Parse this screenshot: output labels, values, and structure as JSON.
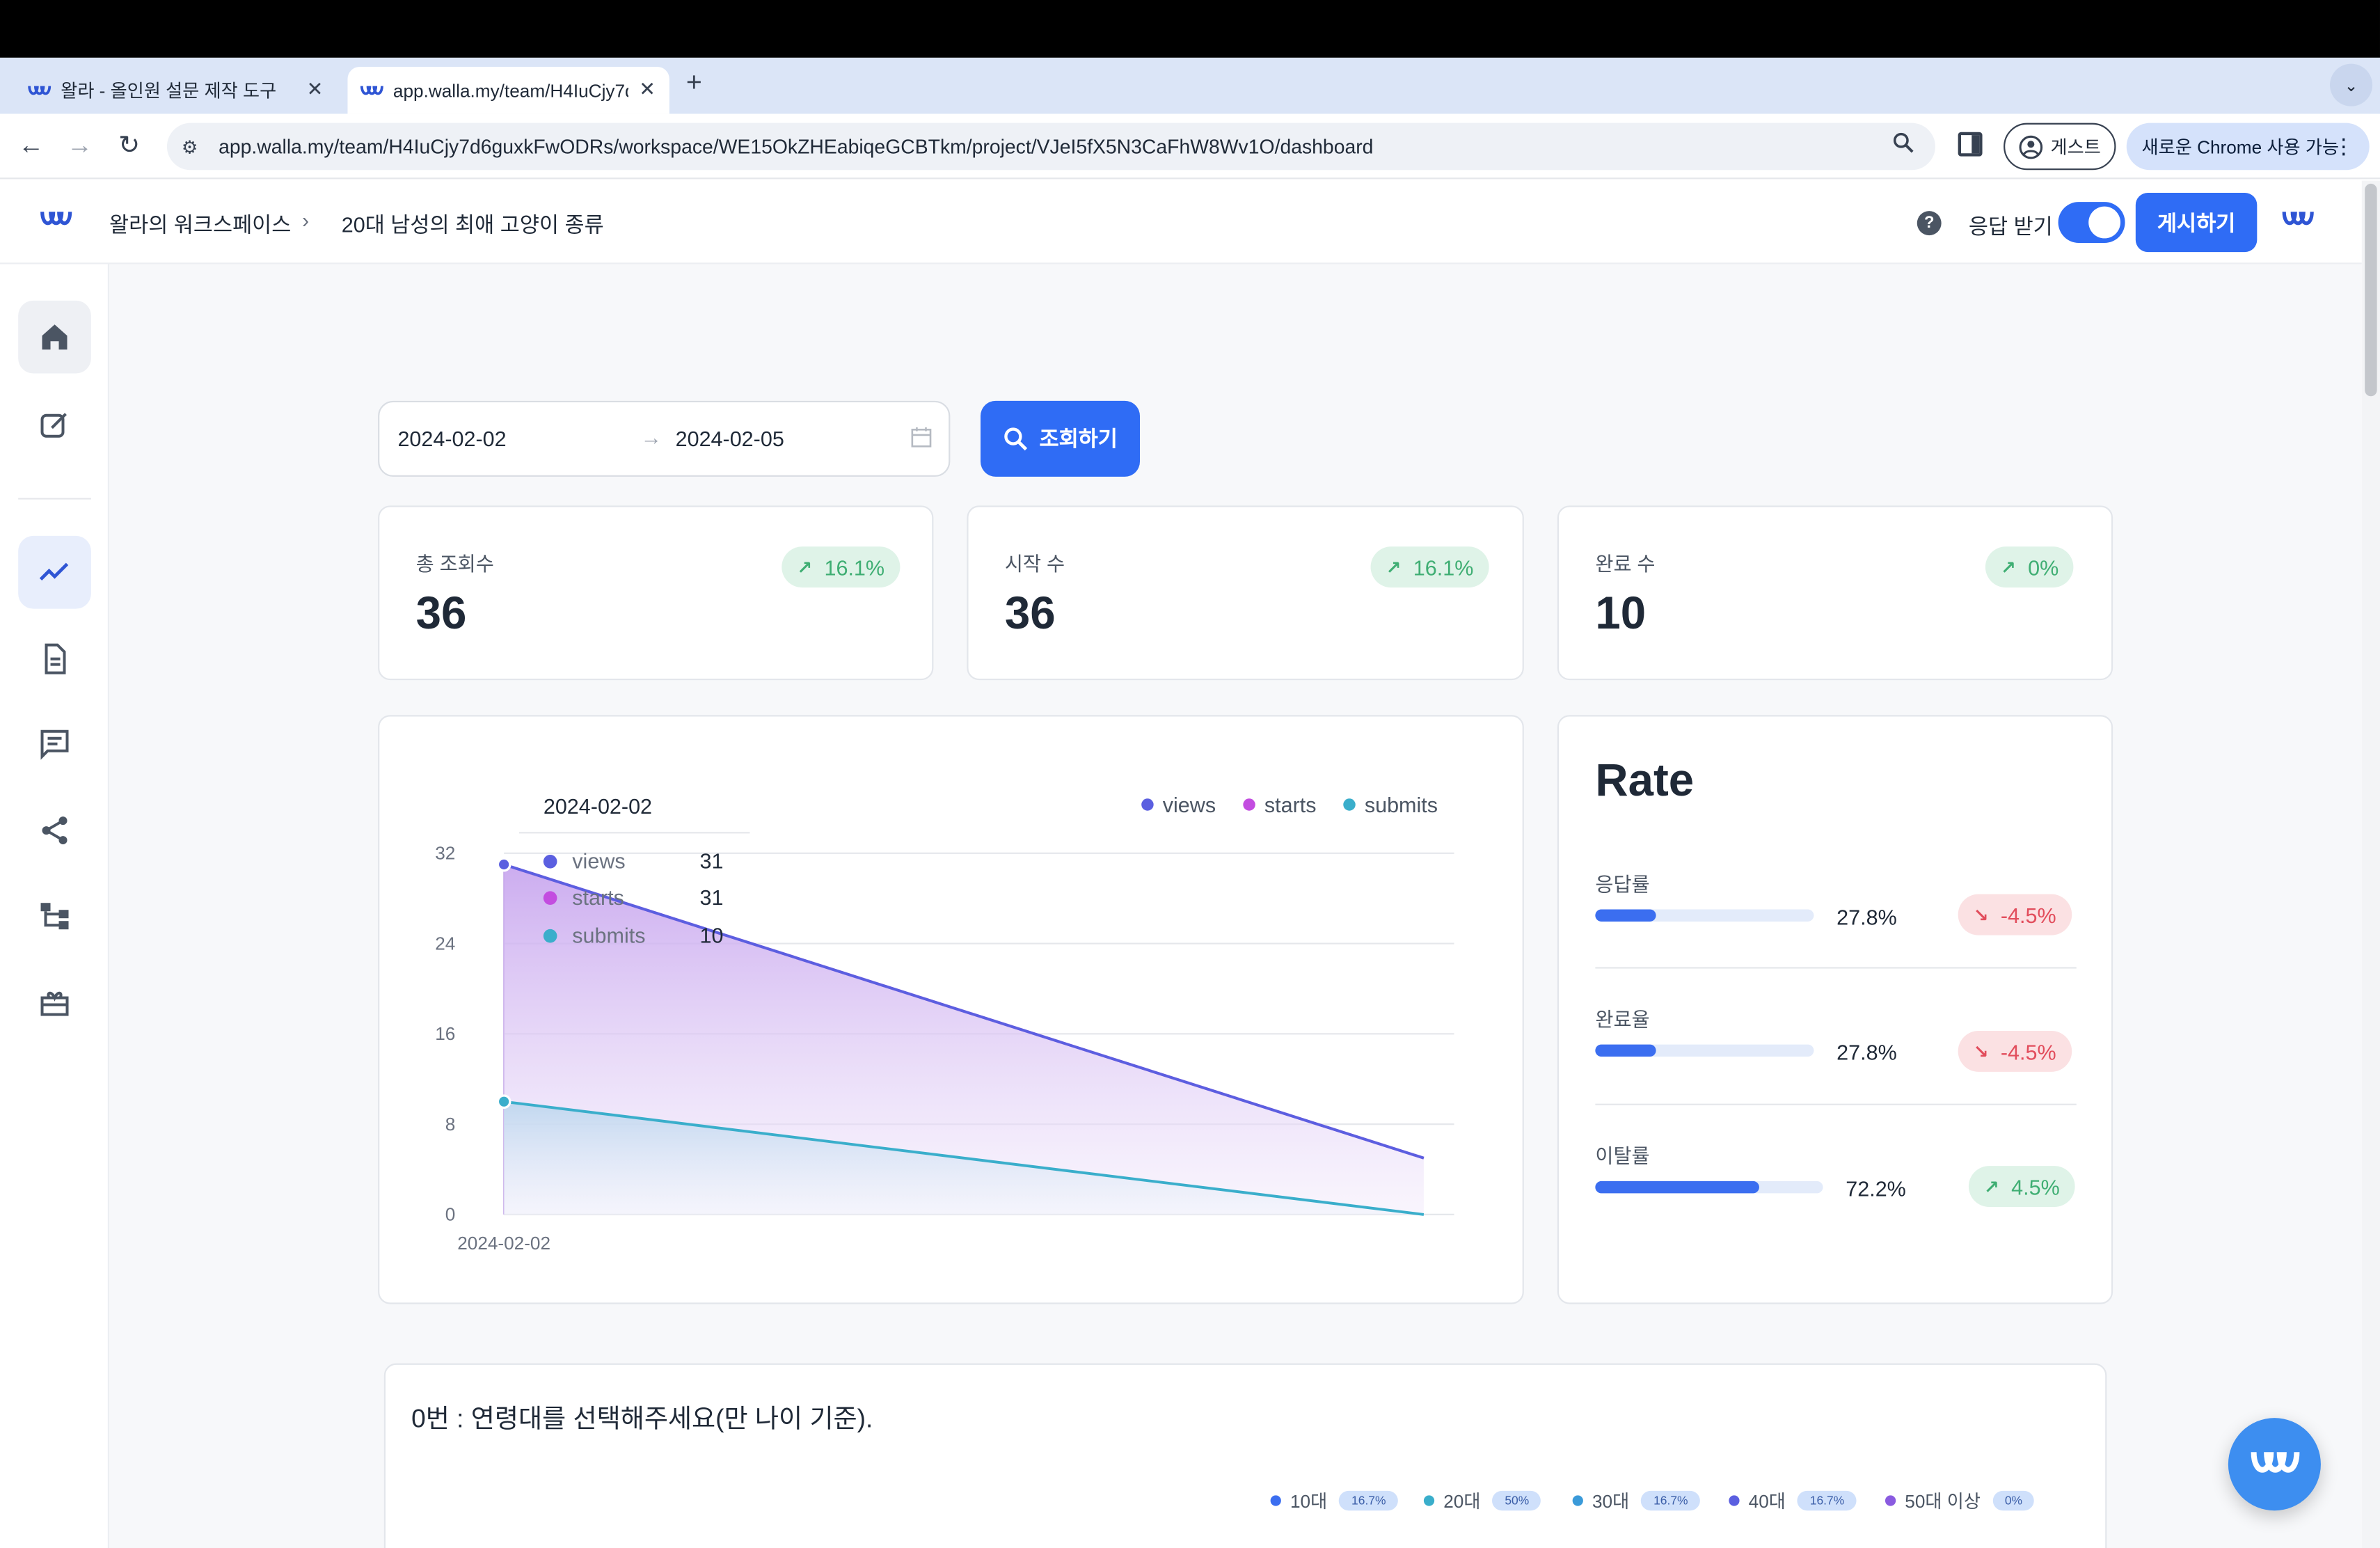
{
  "browser": {
    "tabs": [
      {
        "title": "왈라 - 올인원 설문 제작 도구",
        "active": false
      },
      {
        "title": "app.walla.my/team/H4IuCjy7d",
        "active": true
      }
    ],
    "url": "app.walla.my/team/H4IuCjy7d6guxkFwODRs/workspace/WE15OkZHEabiqeGCBTkm/project/VJeI5fX5N3CaFhW8Wv1O/dashboard",
    "guest_label": "게스트",
    "chrome_available_label": "새로운 Chrome 사용 가능"
  },
  "header": {
    "workspace": "왈라의 워크스페이스",
    "project": "20대 남성의 최애 고양이 종류",
    "response_toggle_label": "응답 받기",
    "response_toggle_on": true,
    "publish_label": "게시하기"
  },
  "filter": {
    "start_date": "2024-02-02",
    "end_date": "2024-02-05",
    "search_label": "조회하기"
  },
  "stats": [
    {
      "label": "총 조회수",
      "value": "36",
      "change": "16.1%",
      "direction": "up"
    },
    {
      "label": "시작 수",
      "value": "36",
      "change": "16.1%",
      "direction": "up"
    },
    {
      "label": "완료 수",
      "value": "10",
      "change": "0%",
      "direction": "up"
    }
  ],
  "chart_data": {
    "type": "area",
    "x": [
      "2024-02-02",
      "2024-02-05"
    ],
    "x_tick_labels": [
      "2024-02-02"
    ],
    "ylim": [
      0,
      32
    ],
    "y_ticks": [
      "0",
      "8",
      "16",
      "24",
      "32"
    ],
    "series": [
      {
        "name": "views",
        "color": "#5b5fe0",
        "values": [
          31,
          5
        ]
      },
      {
        "name": "starts",
        "color": "#c34de0",
        "values": [
          31,
          5
        ]
      },
      {
        "name": "submits",
        "color": "#3aaecb",
        "values": [
          10,
          0
        ]
      }
    ],
    "legend_position": "top-right",
    "grid": true,
    "tooltip": {
      "date": "2024-02-02",
      "rows": [
        {
          "name": "views",
          "value": "31"
        },
        {
          "name": "starts",
          "value": "31"
        },
        {
          "name": "submits",
          "value": "10"
        }
      ]
    }
  },
  "rate": {
    "title": "Rate",
    "items": [
      {
        "label": "응답률",
        "value": "27.8%",
        "fraction": 0.278,
        "change": "-4.5%",
        "direction": "down"
      },
      {
        "label": "완료율",
        "value": "27.8%",
        "fraction": 0.278,
        "change": "-4.5%",
        "direction": "down"
      },
      {
        "label": "이탈률",
        "value": "72.2%",
        "fraction": 0.722,
        "change": "4.5%",
        "direction": "up"
      }
    ]
  },
  "question": {
    "title": "0번 : 연령대를 선택해주세요(만 나이 기준).",
    "legend": [
      {
        "label": "10대",
        "pct": "16.7%",
        "color": "#3b6ef0"
      },
      {
        "label": "20대",
        "pct": "50%",
        "color": "#3aaecb"
      },
      {
        "label": "30대",
        "pct": "16.7%",
        "color": "#3a9ad9"
      },
      {
        "label": "40대",
        "pct": "16.7%",
        "color": "#5b5fe0"
      },
      {
        "label": "50대 이상",
        "pct": "0%",
        "color": "#8a5be0"
      }
    ]
  }
}
